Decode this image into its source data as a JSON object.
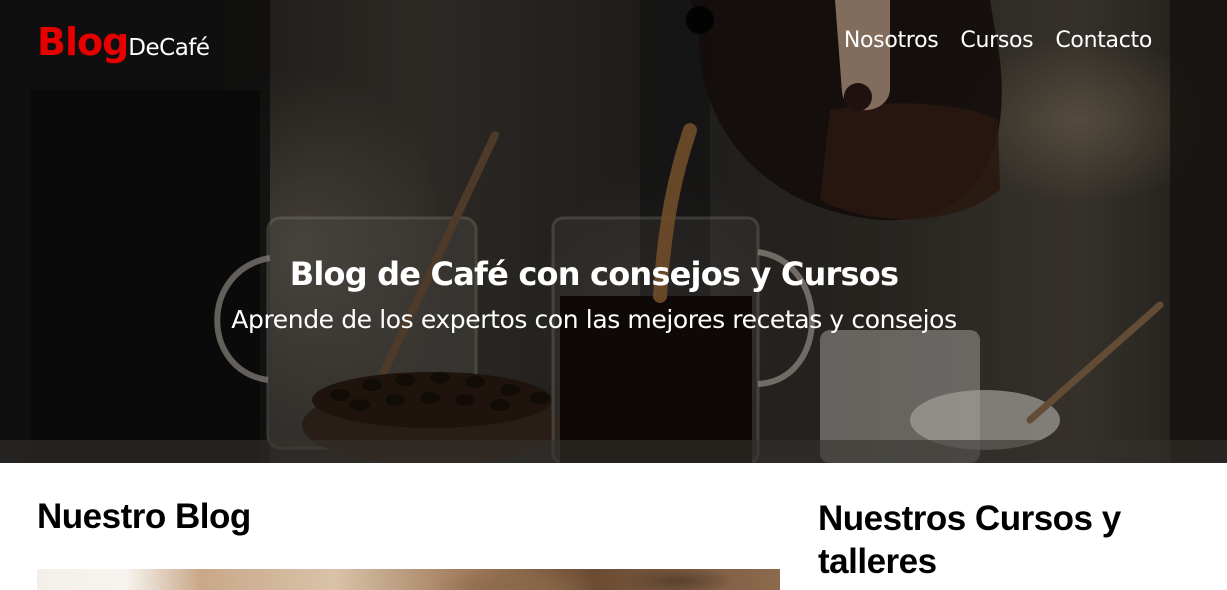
{
  "header": {
    "logo": {
      "part1": "Blog",
      "part2": "DeCafé"
    },
    "nav": [
      {
        "label": "Nosotros"
      },
      {
        "label": "Cursos"
      },
      {
        "label": "Contacto"
      }
    ]
  },
  "hero": {
    "title": "Blog de Café con consejos y Cursos",
    "subtitle": "Aprende de los expertos con las mejores recetas y consejos"
  },
  "main": {
    "blog_heading": "Nuestro Blog",
    "courses_heading": "Nuestros Cursos y talleres"
  },
  "colors": {
    "logo_accent": "#e60000",
    "text_light": "#ffffff",
    "text_dark": "#000000"
  }
}
